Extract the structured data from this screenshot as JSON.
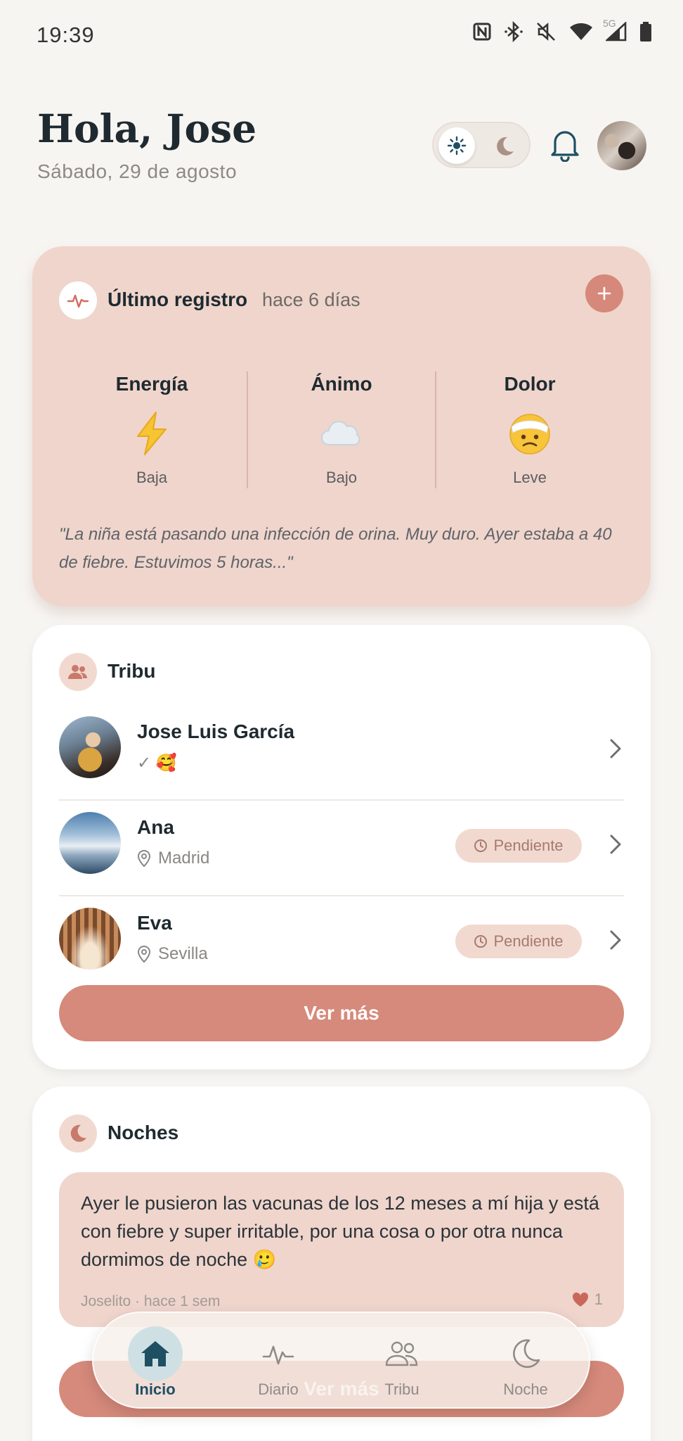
{
  "status_bar": {
    "time": "19:39",
    "network": "5G",
    "icons": [
      "nfc-icon",
      "bluetooth-icon",
      "mute-icon",
      "wifi-icon",
      "signal-icon",
      "battery-icon"
    ]
  },
  "header": {
    "greeting": "Hola, Jose",
    "date": "Sábado, 29 de agosto"
  },
  "registro": {
    "title": "Último registro",
    "subtitle": "hace 6 días",
    "metrics": [
      {
        "label": "Energía",
        "value": "Baja",
        "icon": "lightning-icon"
      },
      {
        "label": "Ánimo",
        "value": "Bajo",
        "icon": "cloud-icon"
      },
      {
        "label": "Dolor",
        "value": "Leve",
        "icon": "bandaged-face-icon"
      }
    ],
    "quote": "\"La niña está pasando una infección de orina. Muy duro. Ayer estaba a 40 de fiebre. Estuvimos 5 horas...\""
  },
  "tribu": {
    "title": "Tribu",
    "members": [
      {
        "name": "Jose Luis García",
        "meta": "✓ 🥰",
        "pending": ""
      },
      {
        "name": "Ana",
        "meta": "Madrid",
        "pending": "Pendiente"
      },
      {
        "name": "Eva",
        "meta": "Sevilla",
        "pending": "Pendiente"
      }
    ],
    "more_button": "Ver más"
  },
  "noches": {
    "title": "Noches",
    "post": {
      "text": "Ayer le pusieron las vacunas de los 12 meses a mí hija y está con fiebre y super irritable, por una cosa o por otra nunca dormimos de noche 🥲",
      "meta": "Joselito · hace 1 sem",
      "likes": "1"
    },
    "more_button": "Ver más"
  },
  "nav": {
    "items": [
      {
        "label": "Inicio",
        "icon": "home-icon",
        "active": true
      },
      {
        "label": "Diario",
        "icon": "pulse-icon",
        "active": false
      },
      {
        "label": "Tribu",
        "icon": "people-icon",
        "active": false
      },
      {
        "label": "Noche",
        "icon": "moon-icon",
        "active": false
      }
    ]
  },
  "colors": {
    "accent": "#d68a7b",
    "card_pink": "#efd5cc",
    "background": "#f7f5f2",
    "text_dark": "#1f2a30",
    "nav_active": "#1f4f62"
  }
}
